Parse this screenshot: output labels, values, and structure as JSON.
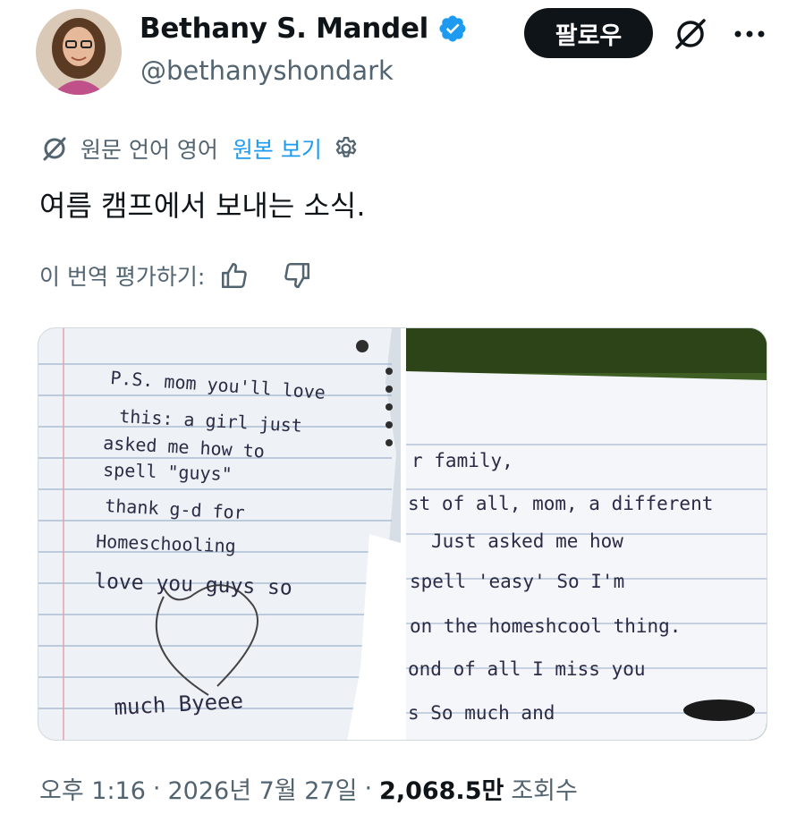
{
  "author": {
    "display_name": "Bethany S. Mandel",
    "handle": "@bethanyshondark",
    "verified": true
  },
  "actions": {
    "follow_label": "팔로우",
    "grok_icon": "grok-icon",
    "more_icon": "more-icon"
  },
  "translation": {
    "notice": "원문 언어 영어",
    "show_original": "원본 보기"
  },
  "tweet": {
    "text": "여름 캠프에서 보내는 소식."
  },
  "rating": {
    "prompt": "이 번역 평가하기:"
  },
  "media": {
    "left_note": [
      "P.S. mom you'll love",
      "this: a girl just",
      "asked me how to",
      "spell \"guys\"",
      "thank g-d for",
      "Homeschooling",
      "love you guys so",
      "much Byeee"
    ],
    "right_note": [
      "r family,",
      "st of all, mom, a different",
      "Just asked me how",
      "spell 'easy' So I'm",
      "on the homeshcool thing.",
      "ond of all I miss you",
      "s So much and"
    ]
  },
  "meta": {
    "time": "오후 1:16",
    "date": "2026년 7월 27일",
    "views_count": "2,068.5만",
    "views_label": "조회수"
  },
  "colors": {
    "accent": "#1d9bf0",
    "text_primary": "#0f1419",
    "text_secondary": "#536471",
    "follow_bg": "#0f1419"
  }
}
